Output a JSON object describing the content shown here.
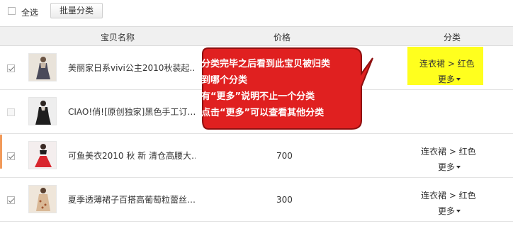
{
  "toolbar": {
    "select_all_label": "全选",
    "batch_button_label": "批量分类"
  },
  "table": {
    "columns": {
      "name": "宝贝名称",
      "price": "价格",
      "category": "分类"
    },
    "more_label": "更多",
    "rows": [
      {
        "title": "美丽家日系vivi公主2010秋装起…",
        "price": "",
        "category": "连衣裙 > 红色",
        "checked": true,
        "thumb": "dress-thumbnail"
      },
      {
        "title": "CIAO!俏![原创独家]黑色手工订…",
        "price": "",
        "category": "",
        "checked": false,
        "thumb": "dress-thumbnail"
      },
      {
        "title": "可鱼美衣2010 秋 新 清仓高腰大…",
        "price": "700",
        "category": "连衣裙 > 红色",
        "checked": true,
        "thumb": "dress-thumbnail"
      },
      {
        "title": "夏季透薄裙子百搭高葡萄粒蕾丝…",
        "price": "300",
        "category": "连衣裙 > 红色",
        "checked": true,
        "thumb": "dress-thumbnail"
      }
    ]
  },
  "callout": {
    "line1": "分类完毕之后看到此宝贝被归类",
    "line2": "到哪个分类",
    "line3": "有“更多”说明不止一个分类",
    "line4": "点击“更多”可以查看其他分类",
    "fill_color": "#e02020",
    "border_color": "#8f1010"
  },
  "colors": {
    "highlight": "#ffff1e",
    "header_bg": "#f0f0f0",
    "accent_edge": "#f19a5a"
  },
  "icons": {
    "checkbox": "checkbox-icon",
    "caret": "caret-down-icon"
  }
}
